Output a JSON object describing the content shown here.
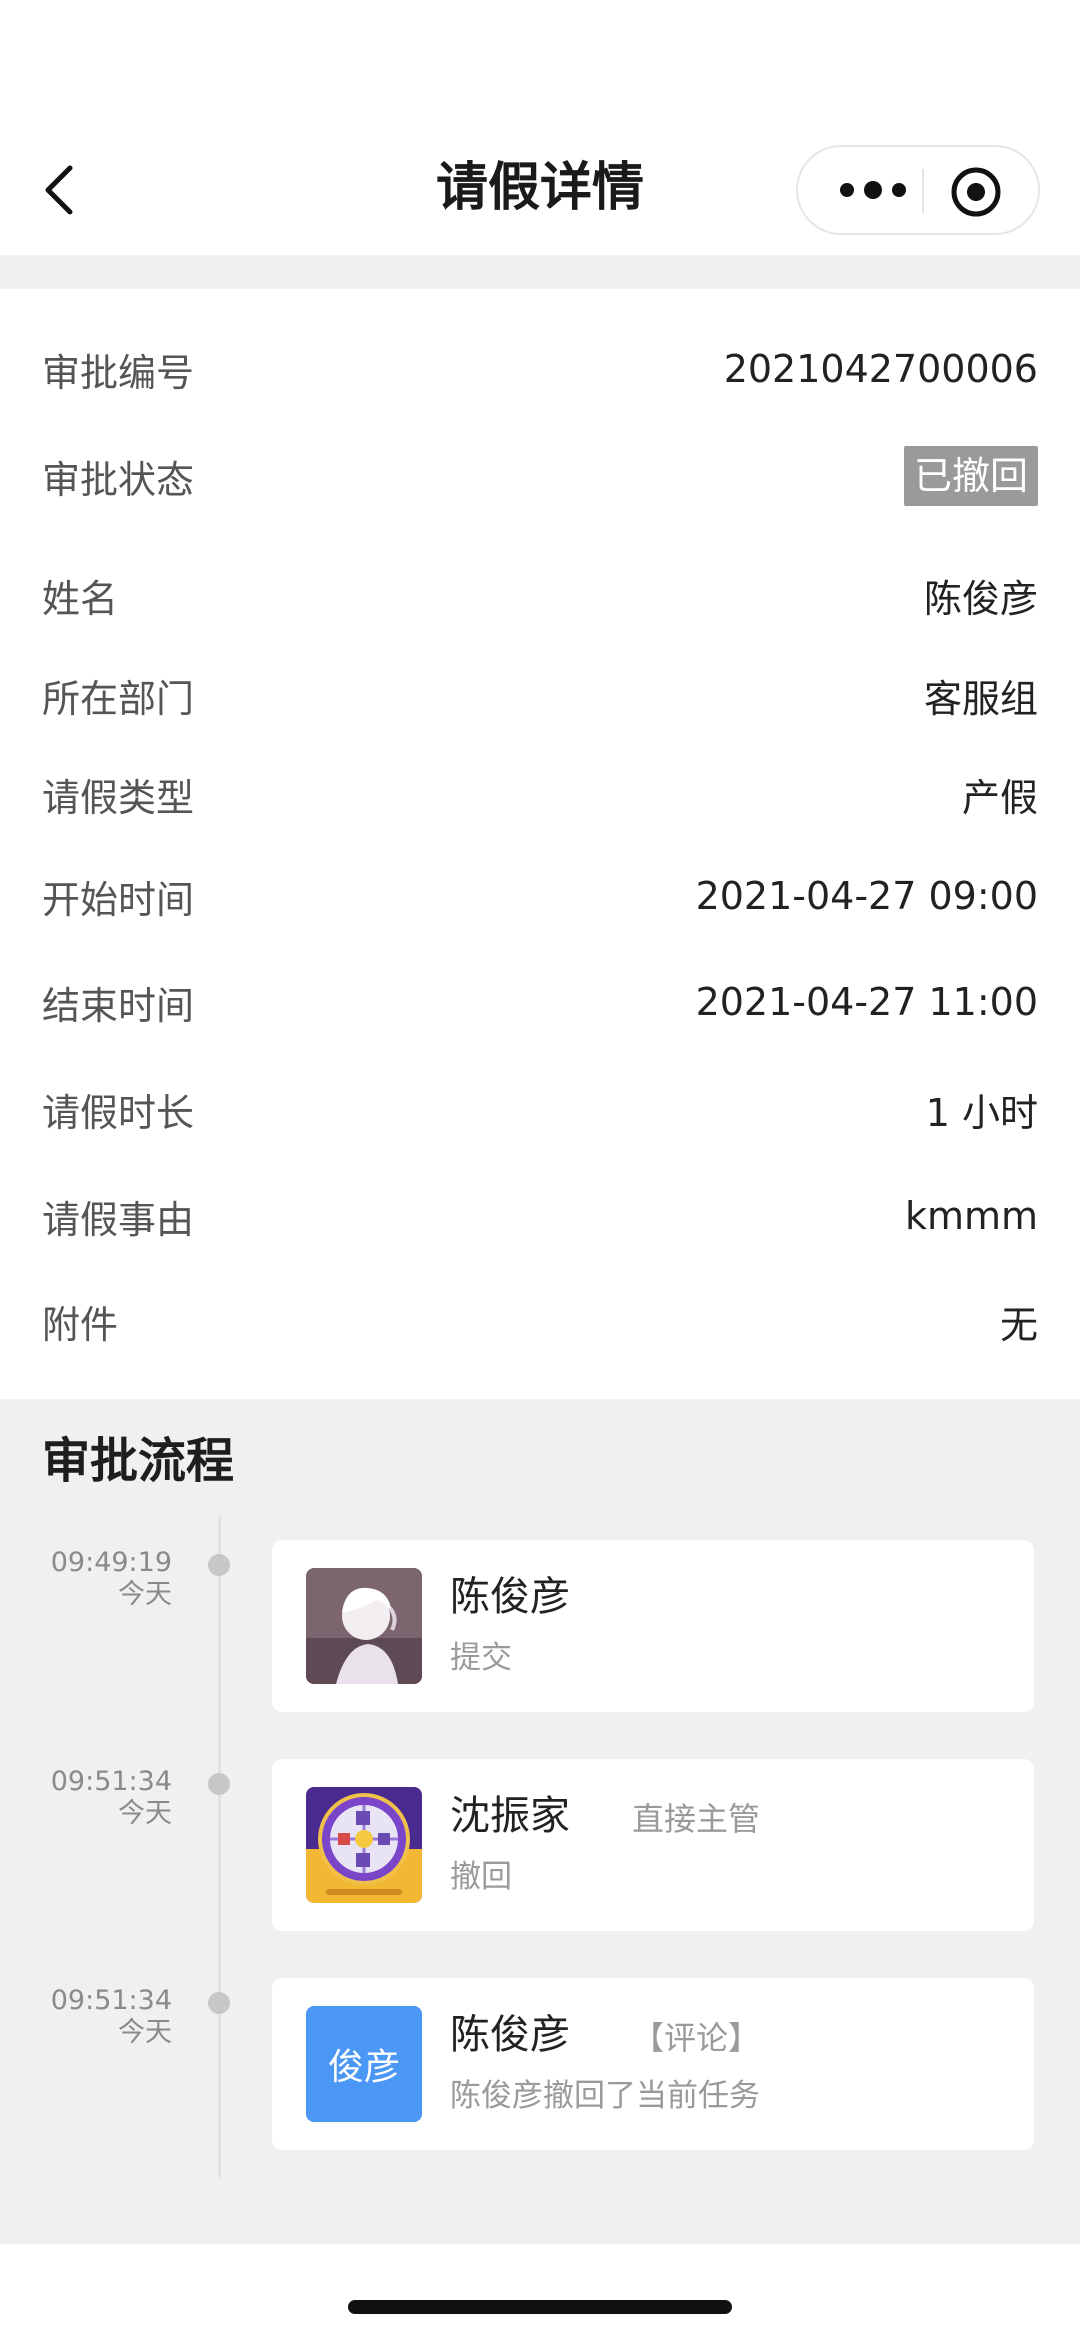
{
  "header": {
    "title": "请假详情"
  },
  "details": [
    {
      "label": "审批编号",
      "value": "2021042700006"
    },
    {
      "label": "审批状态",
      "value": "已撤回"
    },
    {
      "label": "姓名",
      "value": "陈俊彦"
    },
    {
      "label": "所在部门",
      "value": "客服组"
    },
    {
      "label": "请假类型",
      "value": "产假"
    },
    {
      "label": "开始时间",
      "value": "2021-04-27 09:00"
    },
    {
      "label": "结束时间",
      "value": "2021-04-27 11:00"
    },
    {
      "label": "请假时长",
      "value": "1 小时"
    },
    {
      "label": "请假事由",
      "value": "kmmm"
    },
    {
      "label": "附件",
      "value": "无"
    }
  ],
  "process": {
    "title": "审批流程",
    "steps": [
      {
        "time": "09:49:19",
        "day": "今天",
        "name": "陈俊彦",
        "role": "",
        "action": "提交",
        "avatar": "anime-character-avatar"
      },
      {
        "time": "09:51:34",
        "day": "今天",
        "name": "沈振家",
        "role": "直接主管",
        "action": "撤回",
        "avatar": "prize-wheel-avatar"
      },
      {
        "time": "09:51:34",
        "day": "今天",
        "name": "陈俊彦",
        "role": "【评论】",
        "action": "陈俊彦撤回了当前任务",
        "avatar_text": "俊彦"
      }
    ]
  },
  "colors": {
    "status_badge": "#9a9a9a",
    "text_avatar": "#4a97f5",
    "section_bg": "#f0f0f0"
  }
}
